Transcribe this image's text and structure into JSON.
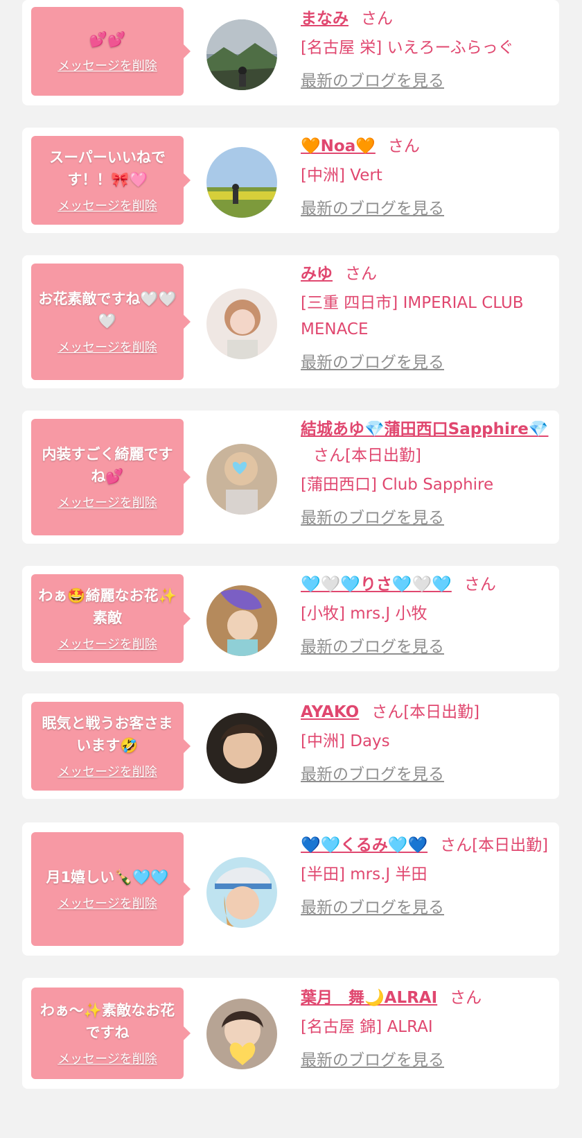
{
  "common": {
    "delete_label": "メッセージを削除",
    "blog_label": "最新のブログを見る"
  },
  "items": [
    {
      "message": "💕💕",
      "name": "まなみ",
      "suffix": "さん",
      "shop": "[名古屋 栄] いえろーふらっぐ",
      "avatar": "photo-outdoor-mountain"
    },
    {
      "message": "スーパーいいねです！！🎀🩷",
      "name": "🧡Noa🧡",
      "suffix": "さん",
      "shop": "[中洲] Vert",
      "avatar": "photo-flower-field"
    },
    {
      "message": "お花素敵ですね🤍🤍🤍",
      "name": "みゆ",
      "suffix": "さん",
      "shop": "[三重 四日市] IMPERIAL CLUB MENACE",
      "avatar": "photo-portrait"
    },
    {
      "message": "内装すごく綺麗ですね💕",
      "name": "結城あゆ💎蒲田西口Sapphire💎",
      "suffix": "さん[本日出勤]",
      "shop": "[蒲田西口] Club Sapphire",
      "avatar": "photo-portrait-heart"
    },
    {
      "message": "わぁ🤩綺麗なお花✨素敵",
      "name": "🩵🤍🩵りさ🩵🤍🩵",
      "suffix": "さん",
      "shop": "[小牧] mrs.J 小牧",
      "avatar": "photo-portrait-hidden"
    },
    {
      "message": "眠気と戦うお客さまいます🤣",
      "name": "AYAKO",
      "suffix": "さん[本日出勤]",
      "shop": "[中洲] Days",
      "avatar": "photo-portrait"
    },
    {
      "message": "月1嬉しい🍾🩵🩵",
      "name": "💙🩵くるみ🩵💙",
      "suffix": "さん[本日出勤]",
      "shop": "[半田] mrs.J 半田",
      "avatar": "photo-portrait-cap"
    },
    {
      "message": "わぁ〜✨素敵なお花ですね",
      "name": "葉月　舞🌙ALRAI",
      "suffix": "さん",
      "shop": "[名古屋 錦] ALRAI",
      "avatar": "photo-portrait-heart"
    }
  ],
  "colors": {
    "bubble": "#f799a4",
    "name": "#e0476f",
    "link_gray": "#8f8f8f",
    "background": "#f2f2f2"
  }
}
